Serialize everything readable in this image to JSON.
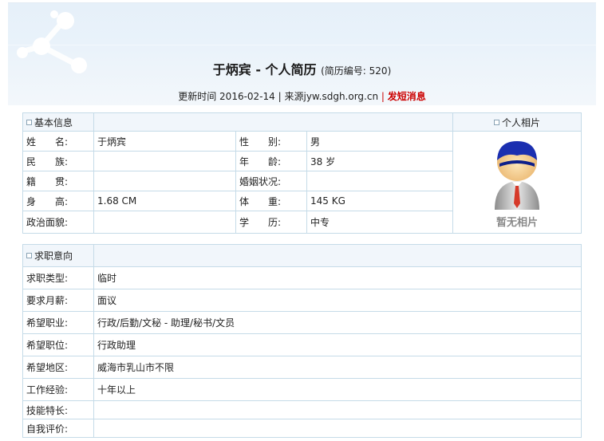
{
  "header": {
    "name": "于炳宾",
    "title_suffix": " - 个人简历",
    "resume_no": "(简历编号: 520)",
    "updated_label": "更新时间",
    "updated_date": "2016-02-14",
    "source_label": "来源",
    "source_site": "jyw.sdgh.org.cn",
    "send_message": "发短消息"
  },
  "basic": {
    "section_title": "基本信息",
    "photo_title": "个人相片",
    "no_photo": "暂无相片",
    "rows": [
      {
        "l1": "姓　　名:",
        "v1": "于炳宾",
        "l2": "性　　别:",
        "v2": "男"
      },
      {
        "l1": "民　　族:",
        "v1": "",
        "l2": "年　　龄:",
        "v2": "38 岁"
      },
      {
        "l1": "籍　　贯:",
        "v1": "",
        "l2": "婚姻状况:",
        "v2": ""
      },
      {
        "l1": "身　　高:",
        "v1": "1.68 CM",
        "l2": "体　　重:",
        "v2": "145 KG"
      },
      {
        "l1": "政治面貌:",
        "v1": "",
        "l2": "学　　历:",
        "v2": "中专"
      }
    ]
  },
  "intent": {
    "section_title": "求职意向",
    "rows": [
      {
        "label": "求职类型:",
        "value": "临时"
      },
      {
        "label": "要求月薪:",
        "value": "面议"
      },
      {
        "label": "希望职业:",
        "value": "行政/后勤/文秘 - 助理/秘书/文员"
      },
      {
        "label": "希望职位:",
        "value": "行政助理"
      },
      {
        "label": "希望地区:",
        "value": "威海市乳山市不限"
      },
      {
        "label": "工作经验:",
        "value": "十年以上"
      },
      {
        "label": "技能特长:",
        "value": ""
      },
      {
        "label": "自我评价:",
        "value": ""
      }
    ]
  }
}
